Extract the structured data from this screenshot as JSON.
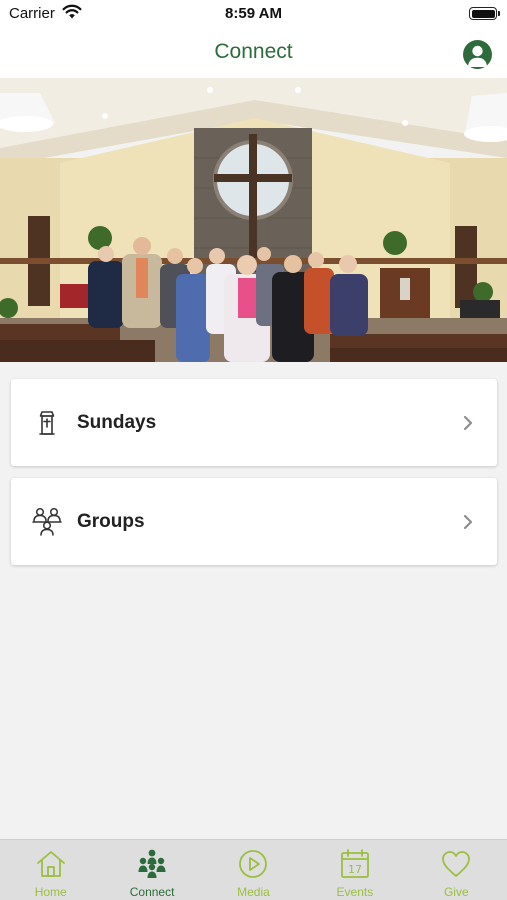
{
  "status_bar": {
    "carrier": "Carrier",
    "time": "8:59 AM"
  },
  "nav": {
    "title": "Connect"
  },
  "menu": [
    {
      "label": "Sundays",
      "icon": "pulpit-icon"
    },
    {
      "label": "Groups",
      "icon": "people-group-icon"
    }
  ],
  "tabs": [
    {
      "label": "Home",
      "icon": "home-icon",
      "active": false
    },
    {
      "label": "Connect",
      "icon": "people-icon",
      "active": true
    },
    {
      "label": "Media",
      "icon": "play-icon",
      "active": false
    },
    {
      "label": "Events",
      "icon": "calendar-icon",
      "active": false
    },
    {
      "label": "Give",
      "icon": "heart-icon",
      "active": false
    }
  ],
  "colors": {
    "brand_green": "#2e6b3c",
    "tab_inactive": "#9bbf3f",
    "background": "#f2f2f2"
  }
}
